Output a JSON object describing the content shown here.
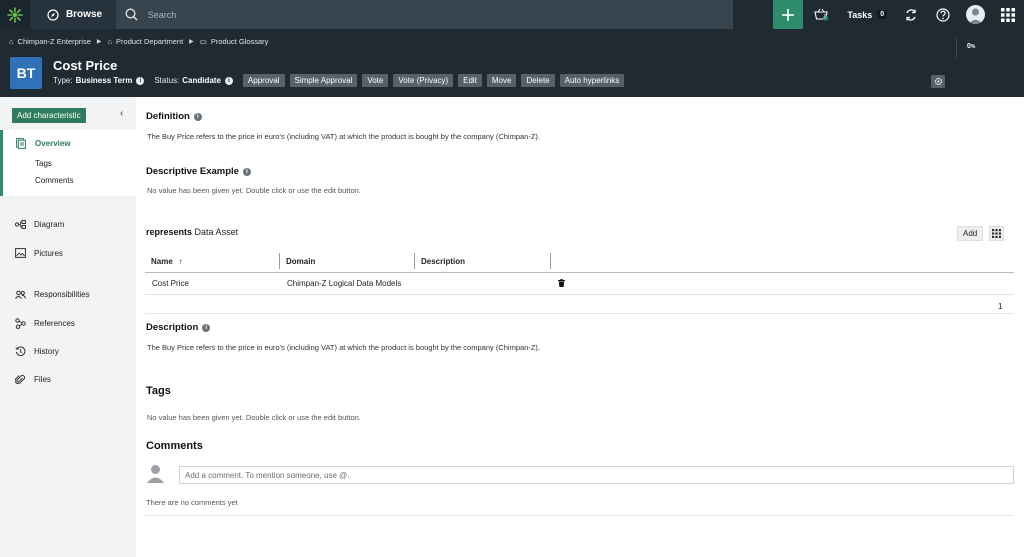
{
  "topbar": {
    "browse_label": "Browse",
    "search_placeholder": "Search",
    "tasks_label": "Tasks",
    "tasks_count": "0",
    "basket_count": "1"
  },
  "header": {
    "breadcrumbs": [
      "Chimpan-Z Enterprise",
      "Product Department",
      "Product Glossary"
    ],
    "progress_value": "0",
    "progress_unit": "%",
    "badge": "BT",
    "title": "Cost Price",
    "type_label": "Type:",
    "type_value": "Business Term",
    "status_label": "Status:",
    "status_value": "Candidate",
    "actions": [
      "Approval",
      "Simple Approval",
      "Vote",
      "Vote (Privacy)",
      "Edit",
      "Move",
      "Delete",
      "Auto hyperlinks"
    ]
  },
  "sidebar": {
    "add_characteristic": "Add characteristic",
    "overview": "Overview",
    "tags": "Tags",
    "comments": "Comments",
    "diagram": "Diagram",
    "pictures": "Pictures",
    "responsibilities": "Responsibilities",
    "references": "References",
    "history": "History",
    "files": "Files"
  },
  "main": {
    "definition_title": "Definition",
    "definition_text": "The Buy Price refers to the price in euro's (including VAT) at which the product is bought by the company (Chimpan-Z).",
    "example_title": "Descriptive Example",
    "example_text": "No value has been given yet. Double click or use the edit button.",
    "relation_keyword": "represents",
    "relation_target": "Data Asset",
    "add_label": "Add",
    "table": {
      "headers": [
        "Name",
        "Domain",
        "Description"
      ],
      "rows": [
        {
          "name": "Cost Price",
          "domain": "Chimpan-Z Logical Data Models",
          "description": ""
        }
      ],
      "page": "1"
    },
    "description_title": "Description",
    "description_text": "The Buy Price refers to the price in euro's (including VAT) at which the product is bought by the company (Chimpan-Z).",
    "tags_title": "Tags",
    "tags_text": "No value has been given yet. Double click or use the edit button.",
    "comments_title": "Comments",
    "comment_placeholder": "Add a comment. To mention someone, use @.",
    "no_comments": "There are no comments yet"
  },
  "colors": {
    "topbar_bg": "#1f2a33",
    "accent_green": "#2e8b6d",
    "badge_blue": "#2f72b8"
  }
}
